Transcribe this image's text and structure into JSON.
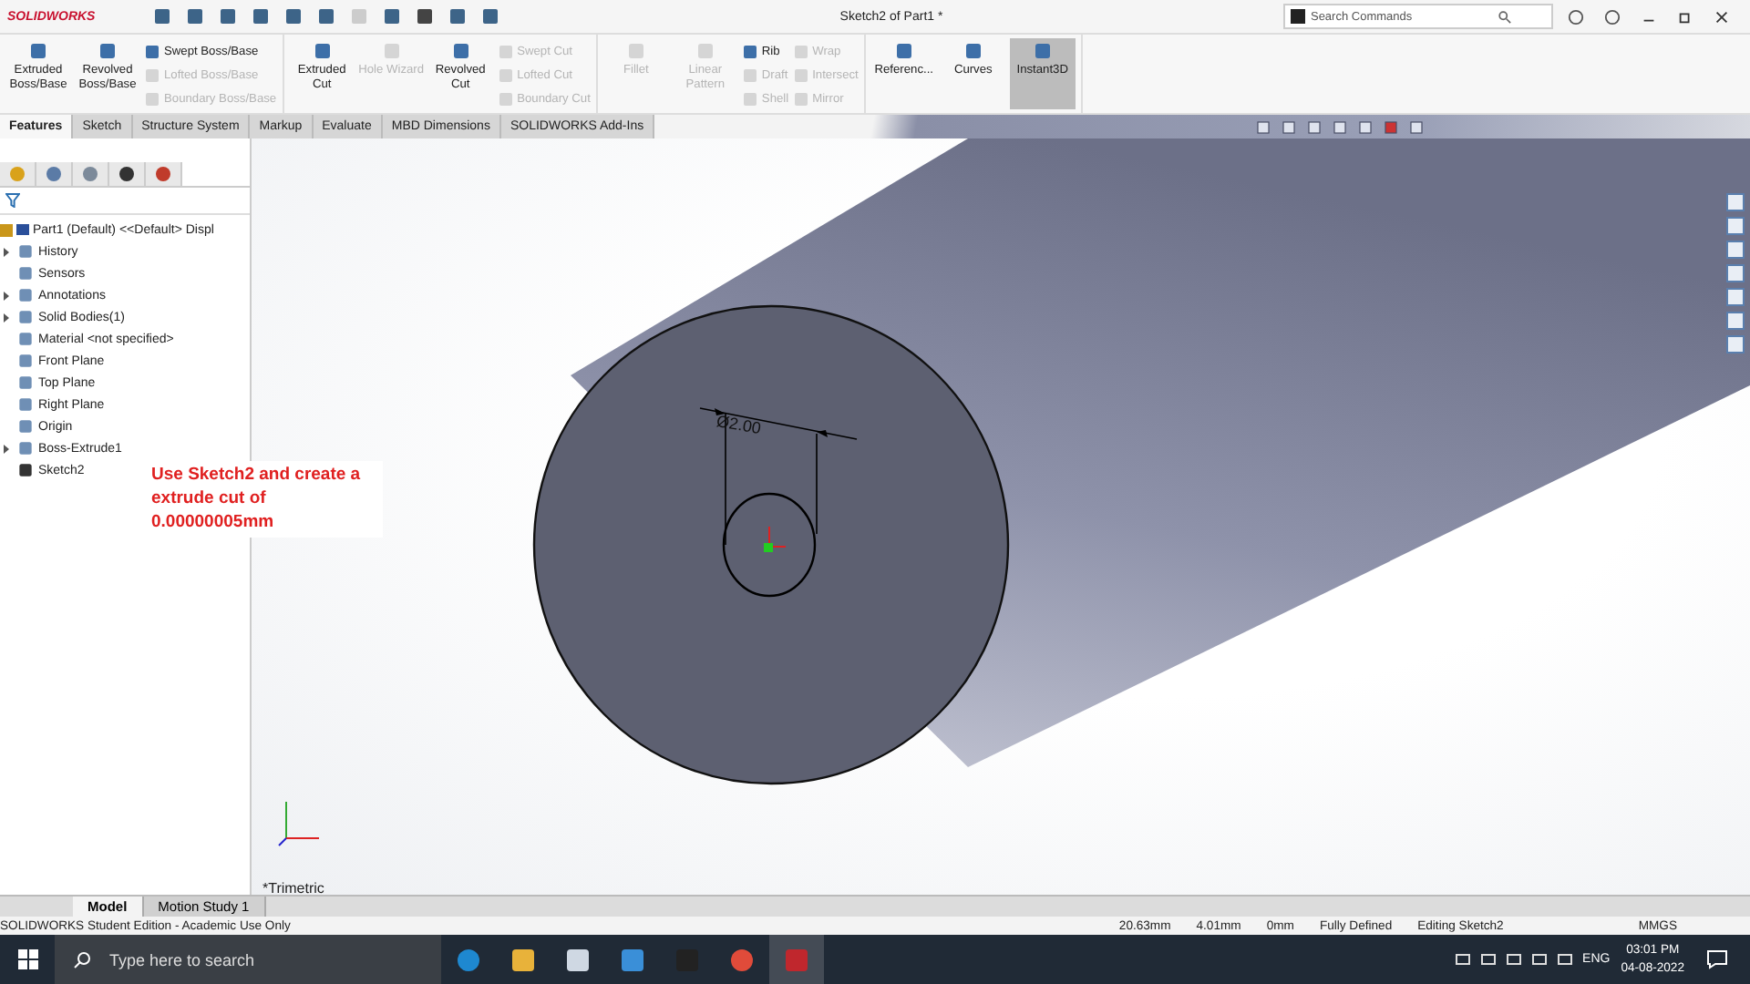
{
  "title_bar": {
    "logo": "SOLIDWORKS",
    "title": "Sketch2 of Part1 *",
    "search": {
      "placeholder": "Search Commands"
    }
  },
  "command_groups": [
    {
      "columns": [
        {
          "kind": "large",
          "label": "Extruded Boss/Base",
          "disabled": false,
          "active": false
        },
        {
          "kind": "large",
          "label": "Revolved Boss/Base",
          "disabled": false,
          "active": false
        },
        {
          "kind": "stack",
          "items": [
            {
              "label": "Swept Boss/Base",
              "disabled": false
            },
            {
              "label": "Lofted Boss/Base",
              "disabled": true
            },
            {
              "label": "Boundary Boss/Base",
              "disabled": true
            }
          ]
        }
      ]
    },
    {
      "columns": [
        {
          "kind": "large",
          "label": "Extruded Cut",
          "disabled": false,
          "active": false
        },
        {
          "kind": "large",
          "label": "Hole Wizard",
          "disabled": true,
          "active": false
        },
        {
          "kind": "large",
          "label": "Revolved Cut",
          "disabled": false,
          "active": false
        },
        {
          "kind": "stack",
          "items": [
            {
              "label": "Swept Cut",
              "disabled": true
            },
            {
              "label": "Lofted Cut",
              "disabled": true
            },
            {
              "label": "Boundary Cut",
              "disabled": true
            }
          ]
        }
      ]
    },
    {
      "columns": [
        {
          "kind": "large",
          "label": "Fillet",
          "disabled": true,
          "active": false
        },
        {
          "kind": "large",
          "label": "Linear Pattern",
          "disabled": true,
          "active": false
        },
        {
          "kind": "stack",
          "items": [
            {
              "label": "Rib",
              "disabled": false
            },
            {
              "label": "Draft",
              "disabled": true
            },
            {
              "label": "Shell",
              "disabled": true
            }
          ]
        },
        {
          "kind": "stack",
          "items": [
            {
              "label": "Wrap",
              "disabled": true
            },
            {
              "label": "Intersect",
              "disabled": true
            },
            {
              "label": "Mirror",
              "disabled": true
            }
          ]
        }
      ]
    },
    {
      "columns": [
        {
          "kind": "large",
          "label": "Referenc...",
          "disabled": false,
          "active": false
        },
        {
          "kind": "large",
          "label": "Curves",
          "disabled": false,
          "active": false
        },
        {
          "kind": "large",
          "label": "Instant3D",
          "disabled": false,
          "active": true
        }
      ]
    }
  ],
  "tabs": [
    {
      "label": "Features",
      "selected": true
    },
    {
      "label": "Sketch",
      "selected": false
    },
    {
      "label": "Structure System",
      "selected": false
    },
    {
      "label": "Markup",
      "selected": false
    },
    {
      "label": "Evaluate",
      "selected": false
    },
    {
      "label": "MBD Dimensions",
      "selected": false
    },
    {
      "label": "SOLIDWORKS Add-Ins",
      "selected": false
    }
  ],
  "feature_tree": {
    "root": "Part1 (Default) <<Default> Displ",
    "items": [
      {
        "label": "History",
        "has_children": true
      },
      {
        "label": "Sensors",
        "has_children": false
      },
      {
        "label": "Annotations",
        "has_children": true
      },
      {
        "label": "Solid Bodies(1)",
        "has_children": true
      },
      {
        "label": "Material <not specified>",
        "has_children": false
      },
      {
        "label": "Front Plane",
        "has_children": false
      },
      {
        "label": "Top Plane",
        "has_children": false
      },
      {
        "label": "Right Plane",
        "has_children": false
      },
      {
        "label": "Origin",
        "has_children": false
      },
      {
        "label": "Boss-Extrude1",
        "has_children": true
      },
      {
        "label": "Sketch2",
        "has_children": false
      }
    ]
  },
  "callout": "Use Sketch2 and create a extrude cut of 0.00000005mm",
  "viewport": {
    "dimension": "Ø2.00",
    "view_label": "*Trimetric"
  },
  "bottom_tabs": [
    {
      "label": "Model",
      "selected": true
    },
    {
      "label": "Motion Study 1",
      "selected": false
    }
  ],
  "status_bar": {
    "edition": "SOLIDWORKS Student Edition - Academic Use Only",
    "fields": [
      "20.63mm",
      "4.01mm",
      "0mm",
      "Fully Defined",
      "Editing Sketch2"
    ],
    "units": "MMGS"
  },
  "taskbar": {
    "search": {
      "placeholder": "Type here to search"
    },
    "language": "ENG",
    "time": "03:01 PM",
    "date": "04-08-2022"
  }
}
